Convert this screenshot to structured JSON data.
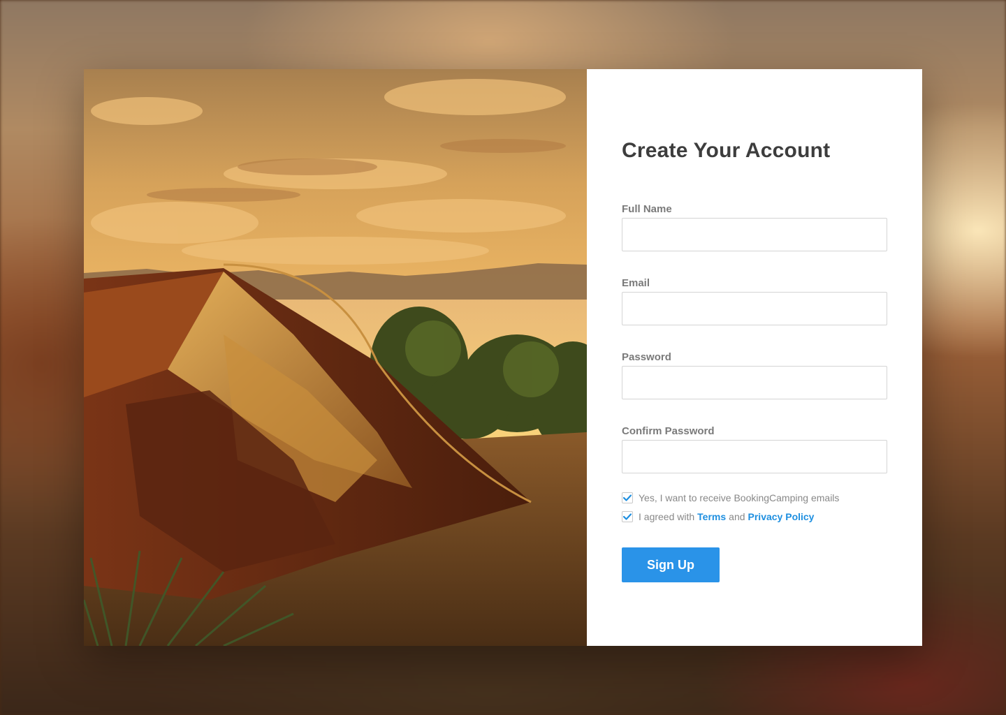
{
  "form": {
    "title": "Create Your Account",
    "fields": [
      {
        "label": "Full Name",
        "value": "",
        "placeholder": ""
      },
      {
        "label": "Email",
        "value": "",
        "placeholder": ""
      },
      {
        "label": "Password",
        "value": "",
        "placeholder": ""
      },
      {
        "label": "Confirm Password",
        "value": "",
        "placeholder": ""
      }
    ],
    "newsletter_text": "Yes, I want to receive BookingCamping emails",
    "newsletter_checked": true,
    "terms_prefix": "I agreed with",
    "terms_link": "Terms",
    "terms_and": "and",
    "privacy_link": "Privacy Policy",
    "terms_checked": true,
    "submit_label": "Sign Up"
  },
  "colors": {
    "accent": "#2a93e8",
    "link": "#1e8fe0",
    "title": "#3d3d3d",
    "label": "#7a7a7a"
  },
  "icons": {
    "checkbox": "check-icon"
  }
}
